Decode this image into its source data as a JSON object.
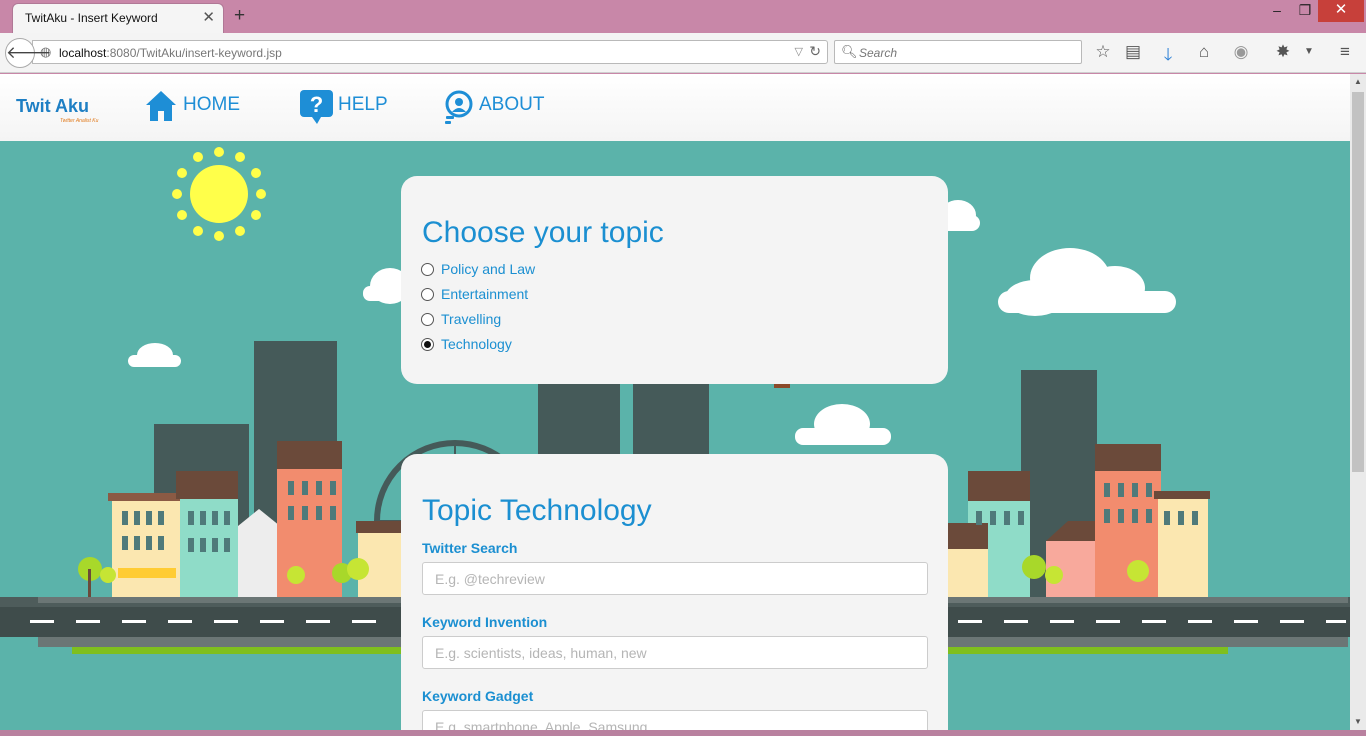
{
  "browser": {
    "tab_title": "TwitAku - Insert Keyword",
    "url_host": "localhost",
    "url_rest": ":8080/TwitAku/insert-keyword.jsp",
    "search_placeholder": "Search"
  },
  "site": {
    "logo": "Twit Aku",
    "logo_tagline": "Twitter Analist Ku",
    "nav": [
      {
        "label": "HOME",
        "icon": "house-icon"
      },
      {
        "label": "HELP",
        "icon": "question-bubble-icon"
      },
      {
        "label": "ABOUT",
        "icon": "lightbulb-face-icon"
      }
    ]
  },
  "topic_card": {
    "title": "Choose your topic",
    "options": [
      {
        "label": "Policy and Law",
        "checked": false
      },
      {
        "label": "Entertainment",
        "checked": false
      },
      {
        "label": "Travelling",
        "checked": false
      },
      {
        "label": "Technology",
        "checked": true
      }
    ]
  },
  "form_card": {
    "title": "Topic Technology",
    "fields": [
      {
        "label": "Twitter Search",
        "placeholder": "E.g. @techreview",
        "value": ""
      },
      {
        "label": "Keyword Invention",
        "placeholder": "E.g. scientists, ideas, human, new",
        "value": ""
      },
      {
        "label": "Keyword Gadget",
        "placeholder": "E.g. smartphone, Apple, Samsung",
        "value": ""
      }
    ]
  },
  "colors": {
    "accent": "#1b8fd1",
    "sky": "#5bb3aa",
    "browser_frame": "#c887a8",
    "card_bg": "#f4f4f4"
  }
}
